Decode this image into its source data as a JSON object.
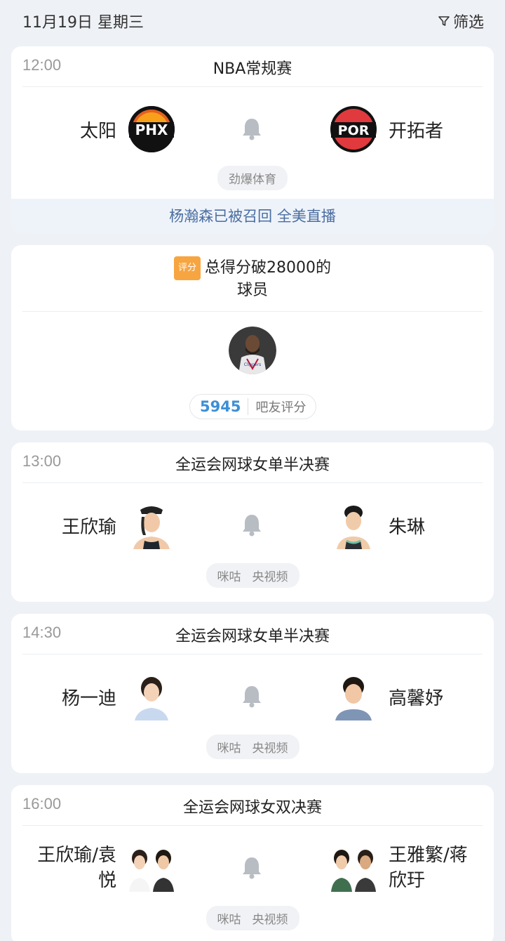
{
  "header": {
    "date": "11月19日 星期三",
    "filter_label": "筛选"
  },
  "matches": [
    {
      "time": "12:00",
      "title": "NBA常规赛",
      "home": {
        "name": "太阳",
        "logo_text": "PHX"
      },
      "away": {
        "name": "开拓者",
        "logo_text": "POR"
      },
      "channels": [
        "劲爆体育"
      ],
      "banner": "杨瀚森已被召回 全美直播"
    },
    {
      "time": "13:00",
      "title": "全运会网球女单半决赛",
      "home": {
        "name": "王欣瑜"
      },
      "away": {
        "name": "朱琳"
      },
      "channels": [
        "咪咕",
        "央视频"
      ]
    },
    {
      "time": "14:30",
      "title": "全运会网球女单半决赛",
      "home": {
        "name": "杨一迪"
      },
      "away": {
        "name": "高馨妤"
      },
      "channels": [
        "咪咕",
        "央视频"
      ]
    },
    {
      "time": "16:00",
      "title": "全运会网球女双决赛",
      "home": {
        "name_line1": "王欣瑜/袁",
        "name_line2": "悦"
      },
      "away": {
        "name_line1": "王雅繁/蒋",
        "name_line2": "欣玗"
      },
      "channels": [
        "咪咕",
        "央视频"
      ]
    }
  ],
  "rating_card": {
    "tag": "评分",
    "title_line1": "总得分破28000的",
    "title_line2": "球员",
    "score": "5945",
    "score_label": "吧友评分"
  },
  "colors": {
    "accent_blue": "#3d8fd6",
    "tag_orange": "#f7a541",
    "banner_text": "#4a6ea0"
  },
  "icons": [
    "filter-icon",
    "bell-icon"
  ]
}
